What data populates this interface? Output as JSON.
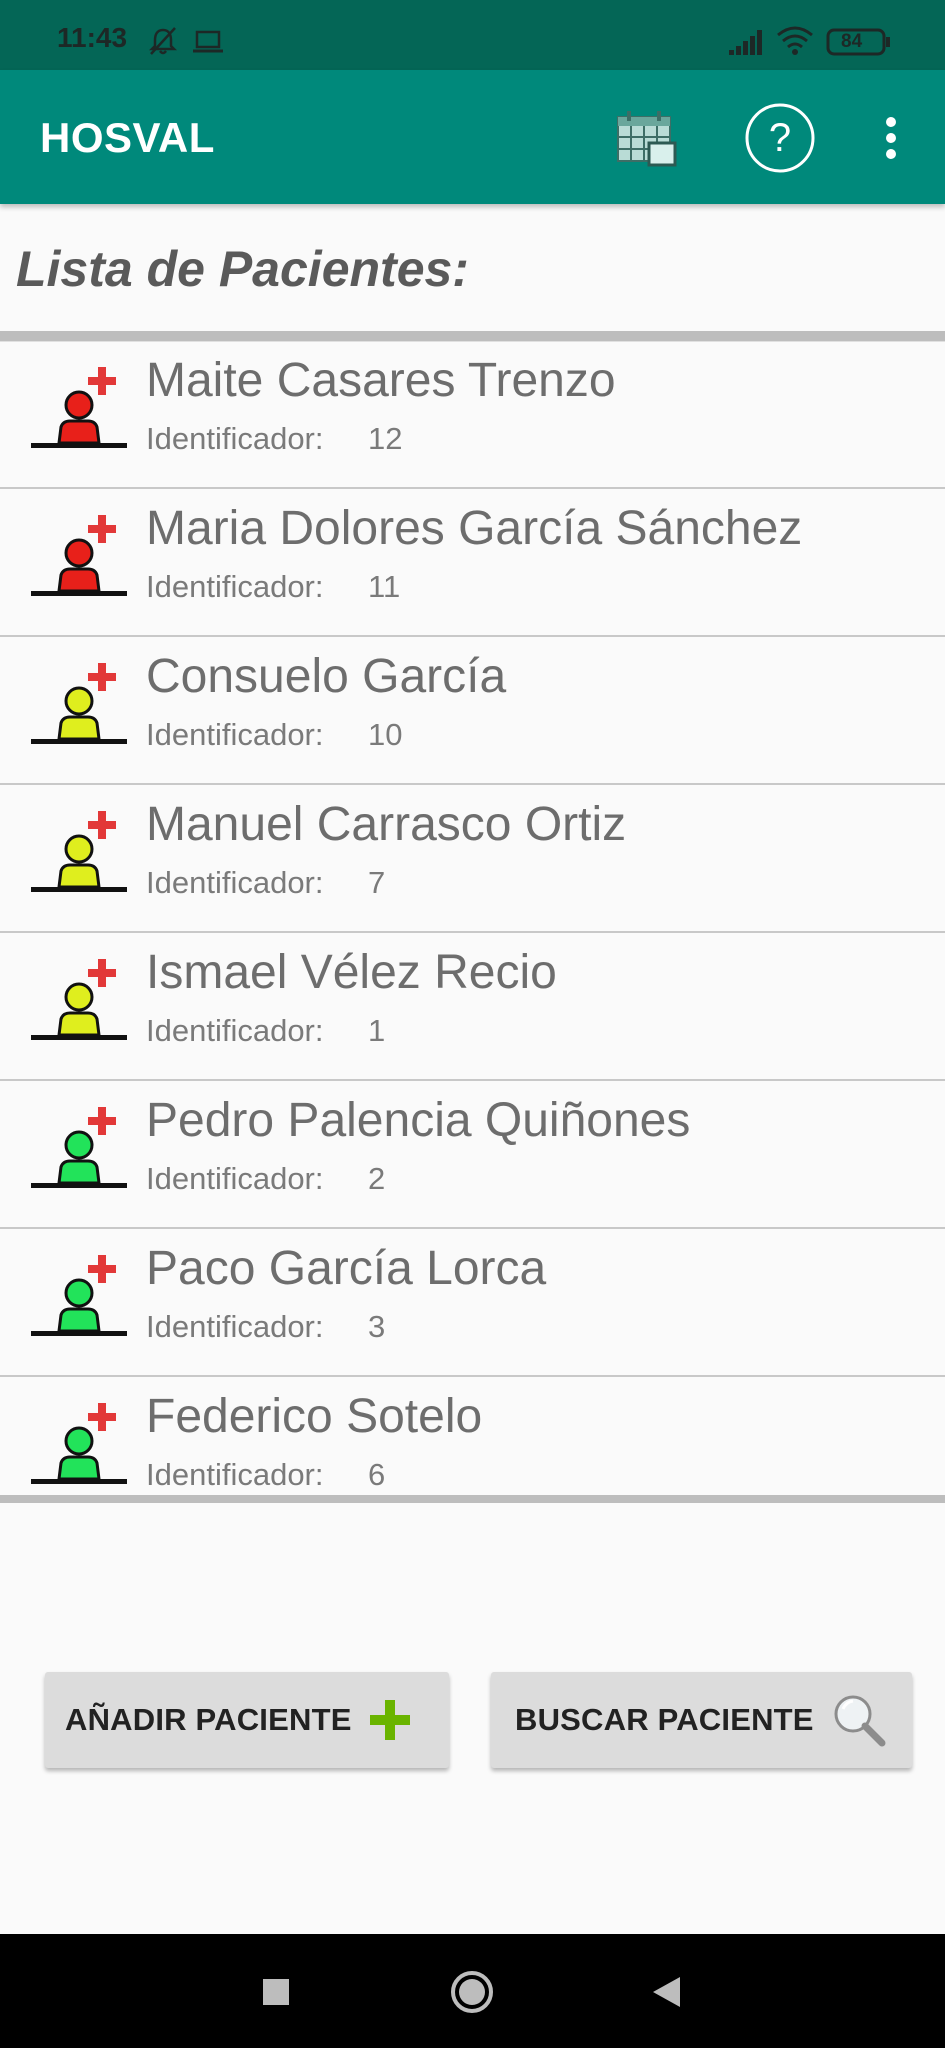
{
  "status_bar": {
    "time": "11:43",
    "battery": "84",
    "icons": [
      "bell-off-icon",
      "laptop-icon",
      "signal-icon",
      "wifi-icon",
      "battery-icon"
    ]
  },
  "app_bar": {
    "title": "HOSVAL",
    "actions": [
      "calendar-icon",
      "help-icon",
      "more-vert-icon"
    ],
    "background": "#00897b"
  },
  "heading": "Lista de Pacientes:",
  "id_label": "Identificador:",
  "patients": [
    {
      "name": "Maite Casares Trenzo",
      "id": "12",
      "status_color": "#e8201a"
    },
    {
      "name": "Maria Dolores García Sánchez",
      "id": "11",
      "status_color": "#e8201a"
    },
    {
      "name": "Consuelo García",
      "id": "10",
      "status_color": "#dfee1e"
    },
    {
      "name": "Manuel Carrasco Ortiz",
      "id": "7",
      "status_color": "#dfee1e"
    },
    {
      "name": "Ismael Vélez Recio",
      "id": "1",
      "status_color": "#dfee1e"
    },
    {
      "name": "Pedro Palencia Quiñones",
      "id": "2",
      "status_color": "#22e35a"
    },
    {
      "name": "Paco García Lorca",
      "id": "3",
      "status_color": "#22e35a"
    },
    {
      "name": "Federico Sotelo",
      "id": "6",
      "status_color": "#22e35a"
    }
  ],
  "buttons": {
    "add": {
      "label": "AÑADIR PACIENTE",
      "icon": "plus-icon"
    },
    "search": {
      "label": "BUSCAR PACIENTE",
      "icon": "magnifier-icon"
    }
  },
  "nav_bar": {
    "buttons": [
      "recents-square-icon",
      "home-circle-icon",
      "back-triangle-icon"
    ]
  }
}
